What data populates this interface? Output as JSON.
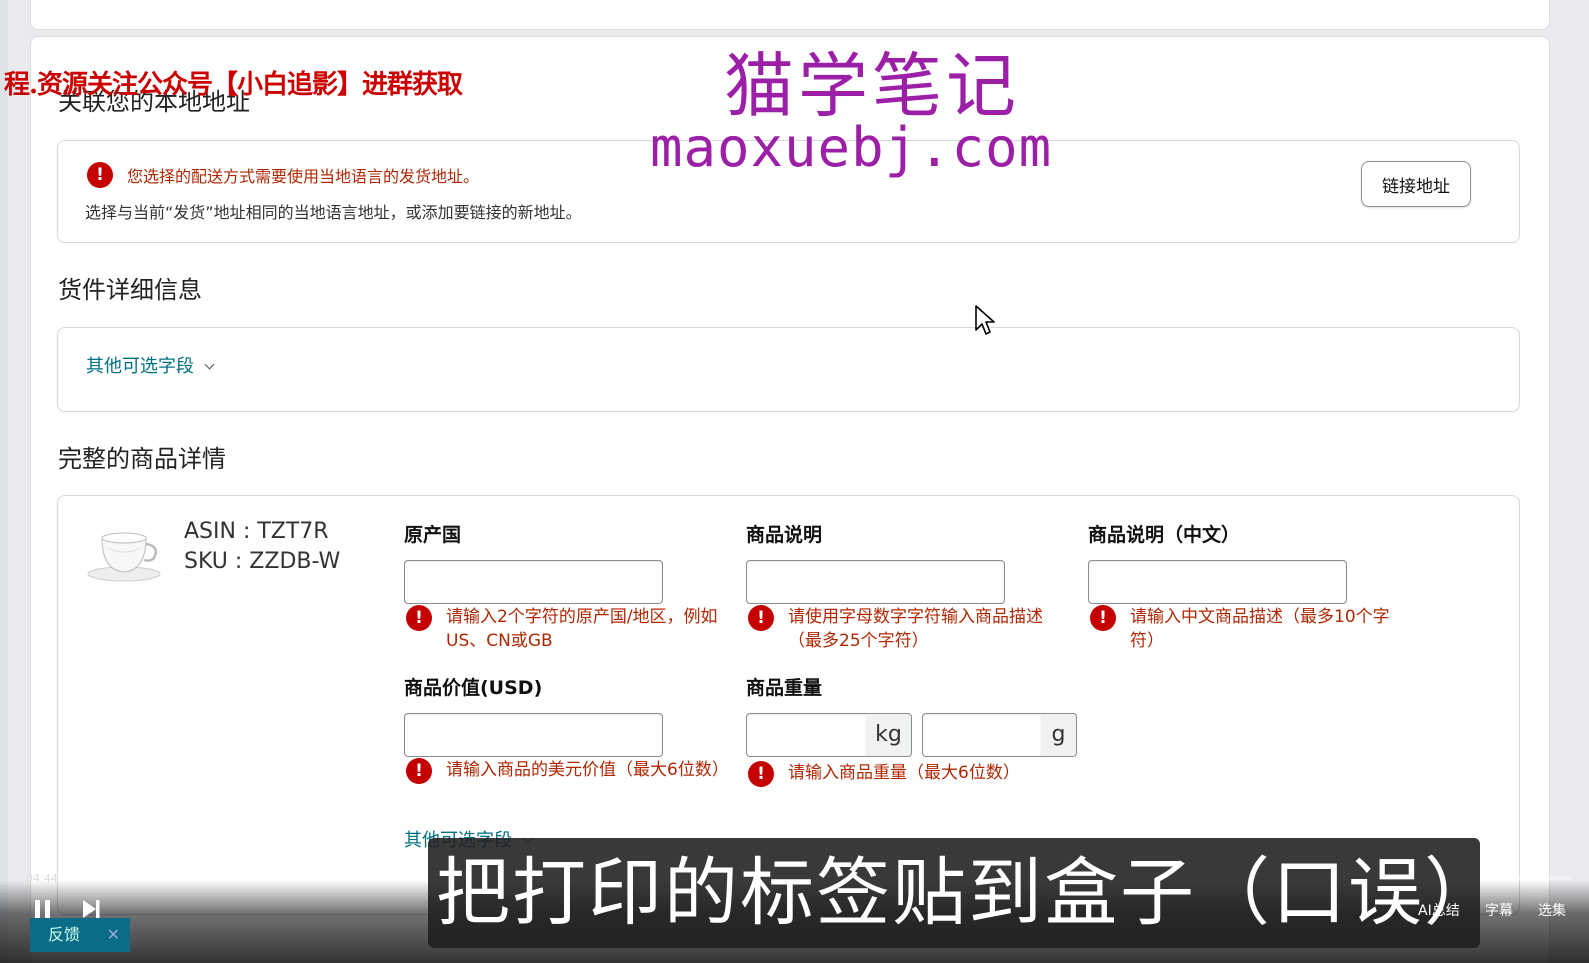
{
  "watermark": {
    "red_banner": "程.资源关注公众号【小白追影】进群获取",
    "title": "猫学笔记",
    "url": "maoxuebj.com"
  },
  "address_section": {
    "title": "关联您的本地地址",
    "alert": "您选择的配送方式需要使用当地语言的发货地址。",
    "hint": "选择与当前“发货”地址相同的当地语言地址，或添加要链接的新地址。",
    "link_button": "链接地址"
  },
  "shipment_section": {
    "title": "货件详细信息",
    "optional_fields": "其他可选字段"
  },
  "product_section": {
    "title": "完整的商品详情",
    "asin": "ASIN : TZT7R",
    "sku": "SKU : ZZDB-W",
    "fields": {
      "origin": {
        "label": "原产国",
        "value": "",
        "error": "请输入2个字符的原产国/地区，例如US、CN或GB"
      },
      "description": {
        "label": "商品说明",
        "value": "",
        "error": "请使用字母数字字符输入商品描述（最多25个字符）"
      },
      "description_cn": {
        "label": "商品说明（中文）",
        "value": "",
        "error": "请输入中文商品描述（最多10个字符）"
      },
      "value_usd": {
        "label": "商品价值(USD)",
        "value": "",
        "error": "请输入商品的美元价值（最大6位数）"
      },
      "weight": {
        "label": "商品重量",
        "kg_value": "",
        "kg_unit": "kg",
        "g_value": "",
        "g_unit": "g",
        "error": "请输入商品重量（最大6位数）"
      }
    },
    "optional_fields": "其他可选字段"
  },
  "player": {
    "time": "04:44",
    "progress": 0.013,
    "subtitle": "把打印的标签贴到盒子（口误）上",
    "feedback": "反馈",
    "feedback_close": "✕",
    "ai_summary": "AI总结",
    "captions": "字幕",
    "episodes": "选集"
  },
  "colors": {
    "error_red": "#b12704",
    "alert_icon": "#c40000",
    "link_teal": "#007185",
    "watermark_purple": "#9b1fa7",
    "watermark_red": "#cc0000"
  }
}
